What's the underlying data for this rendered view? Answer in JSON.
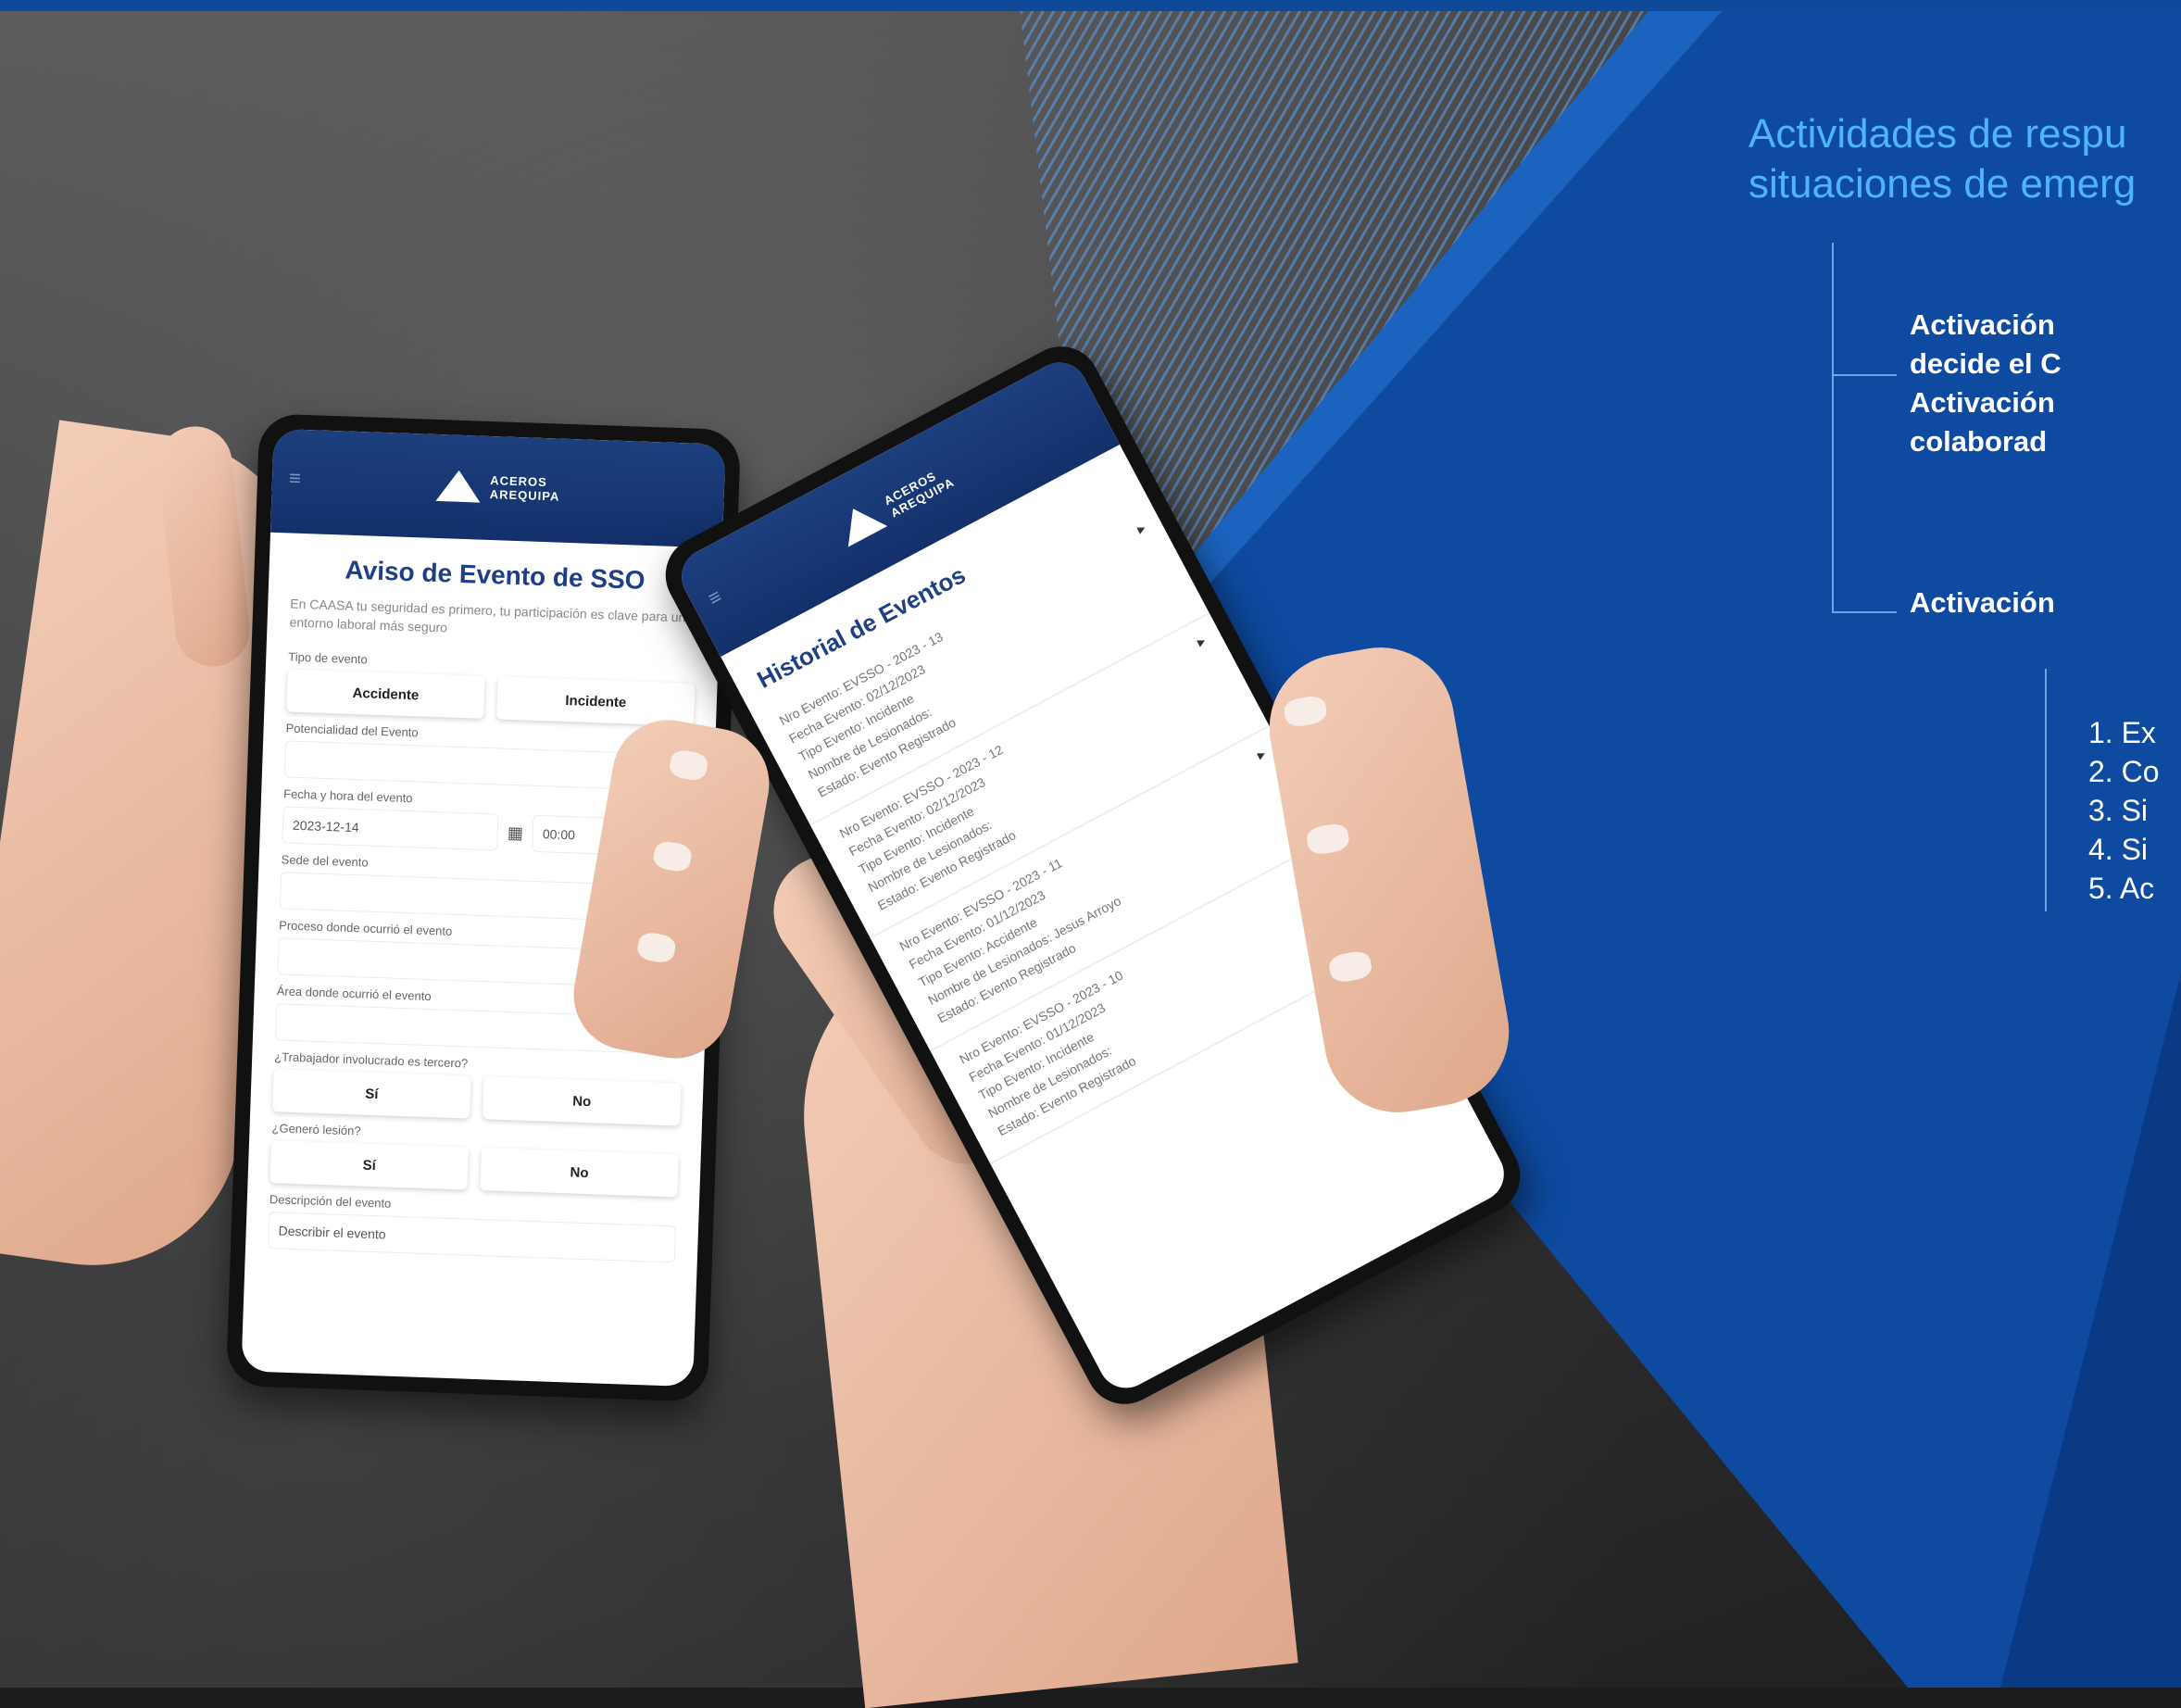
{
  "right_panel": {
    "headline_lines": [
      "Actividades de respu",
      "situaciones de emerg"
    ],
    "activation_block": [
      "Activación",
      "decide el C",
      "Activación",
      "colaborad"
    ],
    "activation_single": "Activación",
    "numbered_items": [
      "1.  Ex",
      "2.  Co",
      "3.  Si",
      "4.  Si",
      "5.  Ac"
    ],
    "colors": {
      "panel": "#0d4aa0",
      "headline": "#4fb3ff"
    }
  },
  "phone_left": {
    "brand": [
      "ACEROS",
      "AREQUIPA"
    ],
    "title": "Aviso de Evento de SSO",
    "subtitle": "En CAASA tu seguridad es primero, tu participación es clave para un entorno laboral más seguro",
    "labels": {
      "tipo": "Tipo de evento",
      "potencialidad": "Potencialidad del Evento",
      "fecha": "Fecha y hora del evento",
      "sede": "Sede del evento",
      "proceso": "Proceso donde ocurrió el evento",
      "area": "Área donde ocurrió el evento",
      "tercero": "¿Trabajador involucrado es tercero?",
      "lesion": "¿Generó lesión?",
      "descripcion": "Descripción del evento"
    },
    "buttons": {
      "accidente": "Accidente",
      "incidente": "Incidente",
      "si1": "Sí",
      "no1": "No",
      "si2": "Sí",
      "no2": "No"
    },
    "date_value": "2023-12-14",
    "time_value": "00:00",
    "desc_placeholder": "Describir el evento"
  },
  "phone_right": {
    "brand": [
      "ACEROS",
      "AREQUIPA"
    ],
    "title": "Historial de Eventos",
    "events": [
      {
        "nro": "Nro Evento: EVSSO - 2023 - 13",
        "fecha": "Fecha Evento: 02/12/2023",
        "tipo": "Tipo Evento: Incidente",
        "nombre": "Nombre de Lesionados:",
        "estado": "Estado: Evento Registrado"
      },
      {
        "nro": "Nro Evento: EVSSO - 2023 - 12",
        "fecha": "Fecha Evento: 02/12/2023",
        "tipo": "Tipo Evento: Incidente",
        "nombre": "Nombre de Lesionados:",
        "estado": "Estado: Evento Registrado"
      },
      {
        "nro": "Nro Evento: EVSSO - 2023 - 11",
        "fecha": "Fecha Evento: 01/12/2023",
        "tipo": "Tipo Evento: Accidente",
        "nombre": "Nombre de Lesionados: Jesus Arroyo",
        "estado": "Estado: Evento Registrado"
      },
      {
        "nro": "Nro Evento: EVSSO - 2023 - 10",
        "fecha": "Fecha Evento: 01/12/2023",
        "tipo": "Tipo Evento: Incidente",
        "nombre": "Nombre de Lesionados:",
        "estado": "Estado: Evento Registrado"
      }
    ]
  }
}
